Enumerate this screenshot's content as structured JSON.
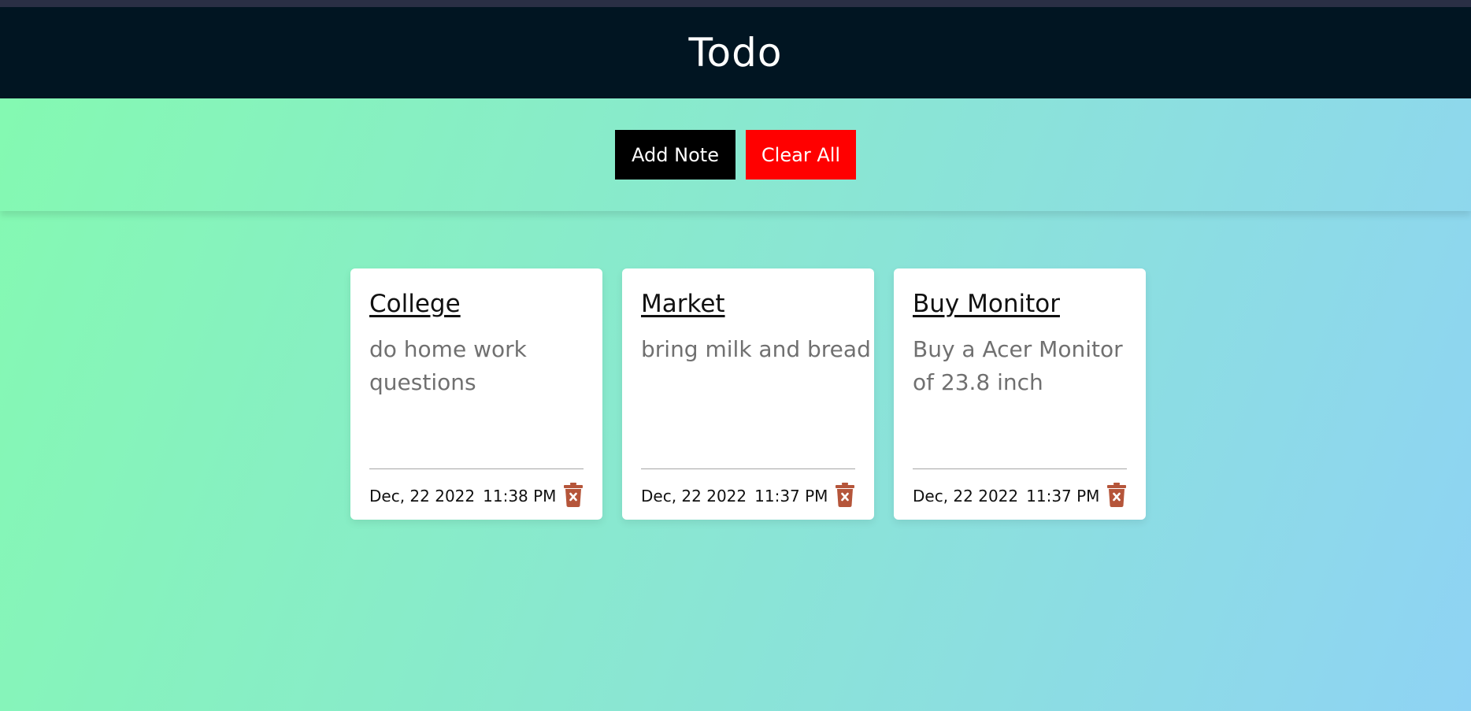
{
  "app": {
    "title": "Todo"
  },
  "toolbar": {
    "add_note_label": "Add Note",
    "clear_all_label": "Clear All"
  },
  "notes": [
    {
      "title": "College",
      "description": "do home work questions",
      "date": "Dec, 22 2022",
      "time": "11:38 PM",
      "delete_icon": "trash-x-icon"
    },
    {
      "title": "Market",
      "description": "bring milk and bread",
      "date": "Dec, 22 2022",
      "time": "11:37 PM",
      "delete_icon": "trash-x-icon"
    },
    {
      "title": "Buy Monitor",
      "description": "Buy a Acer Monitor of 23.8 inch",
      "date": "Dec, 22 2022",
      "time": "11:37 PM",
      "delete_icon": "trash-x-icon"
    }
  ],
  "colors": {
    "header_bg": "#011522",
    "gradient_start": "#84fab0",
    "gradient_end": "#8fd3f4",
    "add_button_bg": "#000000",
    "clear_button_bg": "#ff0000",
    "delete_icon_color": "#b5553a"
  }
}
